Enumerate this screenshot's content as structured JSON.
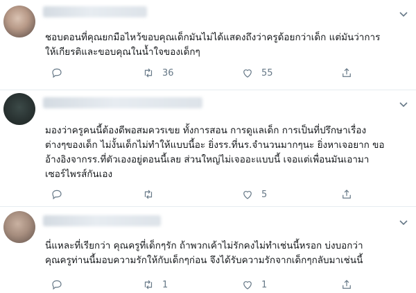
{
  "tweets": [
    {
      "text": "ชอบตอนที่คุณยกมือไหว้ขอบคุณเด็กมันไม่ได้แสดงถึงว่าครูด้อยกว่าเด็ก แต่มันว่าการ\nให้เกียรติและขอบคุณในน้ำใจของเด็กๆ",
      "retweets": "36",
      "likes": "55"
    },
    {
      "text": "มองว่าครูคนนี้ต้องดีพอสมควรเขย ทั้งการสอน การดูแลเด็ก การเป็นที่ปรึกษาเรื่อง\nต่างๆของเด็ก ไม่งั้นเด็กไม่ทำให้แบบนี้อะ ยิ่งรร.ที่นร.จำนวนมากๆนะ ยิ่งหาเจอยาก ขอ\nอ้างอิงจากรร.ที่ตัวเองอยู่ตอนนี้เลย ส่วนใหญ่ไม่เจออะแบบนี้ เจอแต่เพื่อนมันเอามา\nเซอร์ไพรส์กันเอง",
      "retweets": "",
      "likes": "5"
    },
    {
      "text": "นี่แหละที่เรียกว่า คุณครูที่เด็กๆรัก ถ้าพวกเค้าไม่รักคงไม่ทำเช่นนี้หรอก บ่งบอกว่า\nคุณครูท่านนี้มอบความรักให้กับเด็กๆก่อน จึงได้รับความรักจากเด็กๆกลับมาเช่นนี้",
      "retweets": "1",
      "likes": "1"
    }
  ]
}
